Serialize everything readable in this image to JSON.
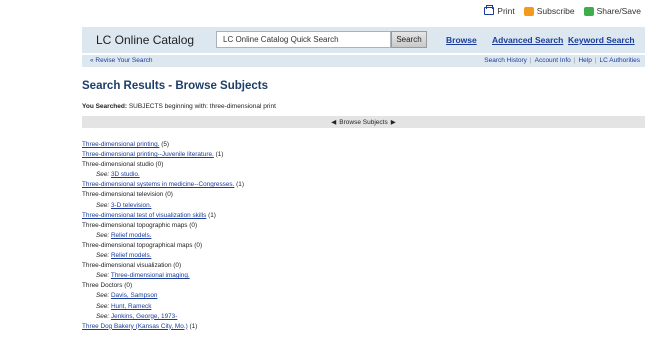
{
  "utility": {
    "print": "Print",
    "subscribe": "Subscribe",
    "share": "Share/Save"
  },
  "header": {
    "logo": "LC Online Catalog",
    "search_value": "LC Online Catalog Quick Search",
    "search_button": "Search",
    "nav": {
      "browse": "Browse",
      "advanced": "Advanced Search",
      "keyword": "Keyword Search"
    }
  },
  "subnav": {
    "revise": "« Revise Your Search",
    "history": "Search History",
    "account": "Account Info",
    "help": "Help",
    "authorities": "LC Authorities",
    "sep": "|"
  },
  "page": {
    "title": "Search Results - Browse Subjects",
    "searched_label": "You Searched:",
    "searched_value": "SUBJECTS beginning with: three-dimensional print"
  },
  "browse_bar": {
    "prev": "◀",
    "label": "Browse Subjects",
    "next": "▶"
  },
  "results": [
    {
      "type": "heading",
      "text": "Three-dimensional printing.",
      "linked": true,
      "count": "(5)"
    },
    {
      "type": "heading",
      "text": "Three-dimensional printing--Juvenile literature.",
      "linked": true,
      "count": "(1)"
    },
    {
      "type": "heading",
      "text": "Three-dimensional studio",
      "linked": false,
      "count": "(0)"
    },
    {
      "type": "see",
      "label": "See:",
      "text": "3D studio."
    },
    {
      "type": "heading",
      "text": "Three-dimensional systems in medicine--Congresses.",
      "linked": true,
      "count": "(1)"
    },
    {
      "type": "heading",
      "text": "Three-dimensional television",
      "linked": false,
      "count": "(0)"
    },
    {
      "type": "see",
      "label": "See:",
      "text": "3-D television."
    },
    {
      "type": "heading",
      "text": "Three-dimensional test of visualization skills",
      "linked": true,
      "count": "(1)"
    },
    {
      "type": "heading",
      "text": "Three-dimensional topographic maps",
      "linked": false,
      "count": "(0)"
    },
    {
      "type": "see",
      "label": "See:",
      "text": "Relief models."
    },
    {
      "type": "heading",
      "text": "Three-dimensional topographical maps",
      "linked": false,
      "count": "(0)"
    },
    {
      "type": "see",
      "label": "See:",
      "text": "Relief models."
    },
    {
      "type": "heading",
      "text": "Three-dimensional visualization",
      "linked": false,
      "count": "(0)"
    },
    {
      "type": "see",
      "label": "See:",
      "text": "Three-dimensional imaging."
    },
    {
      "type": "heading",
      "text": "Three Doctors",
      "linked": false,
      "count": "(0)"
    },
    {
      "type": "see",
      "label": "See:",
      "text": "Davis, Sampson"
    },
    {
      "type": "see",
      "label": "See:",
      "text": "Hunt, Rameck"
    },
    {
      "type": "see",
      "label": "See:",
      "text": "Jenkins, George, 1973-"
    },
    {
      "type": "heading",
      "text": "Three Dog Bakery (Kansas City, Mo.)",
      "linked": true,
      "count": "(1)"
    }
  ],
  "colors": {
    "header_bg": "#dde7ef",
    "link": "#1a3c9c",
    "title": "#1d3e66",
    "browse_bar_bg": "#e4e4e4"
  }
}
